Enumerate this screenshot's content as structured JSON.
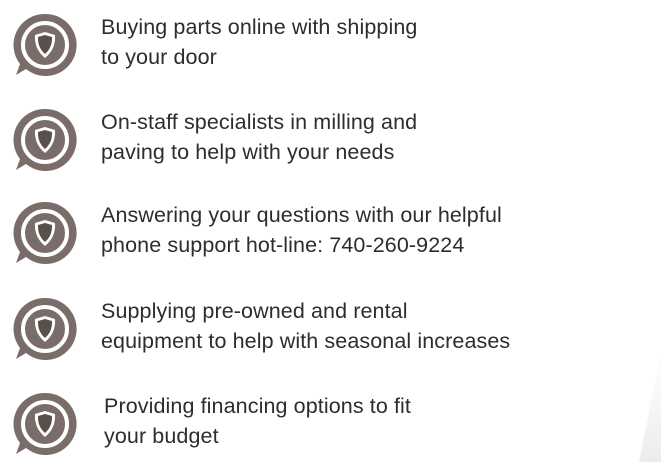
{
  "colors": {
    "badge_outer": "#7a6d69",
    "badge_inner_ring": "#ffffff",
    "shield": "#5b4f4c",
    "text": "#2d2d2d"
  },
  "features": [
    {
      "line1": "Buying parts online with shipping",
      "line2": "to your door"
    },
    {
      "line1": "On-staff specialists in milling and",
      "line2": "paving to help with your needs"
    },
    {
      "line1": "Answering your questions with our helpful",
      "line2": "phone support hot-line: 740-260-9224"
    },
    {
      "line1": "Supplying pre-owned and rental",
      "line2": "equipment to help with seasonal increases"
    },
    {
      "line1": "Providing financing options to fit",
      "line2": "your budget"
    }
  ],
  "icons": {
    "badge": "shield-speech-bubble-icon"
  }
}
